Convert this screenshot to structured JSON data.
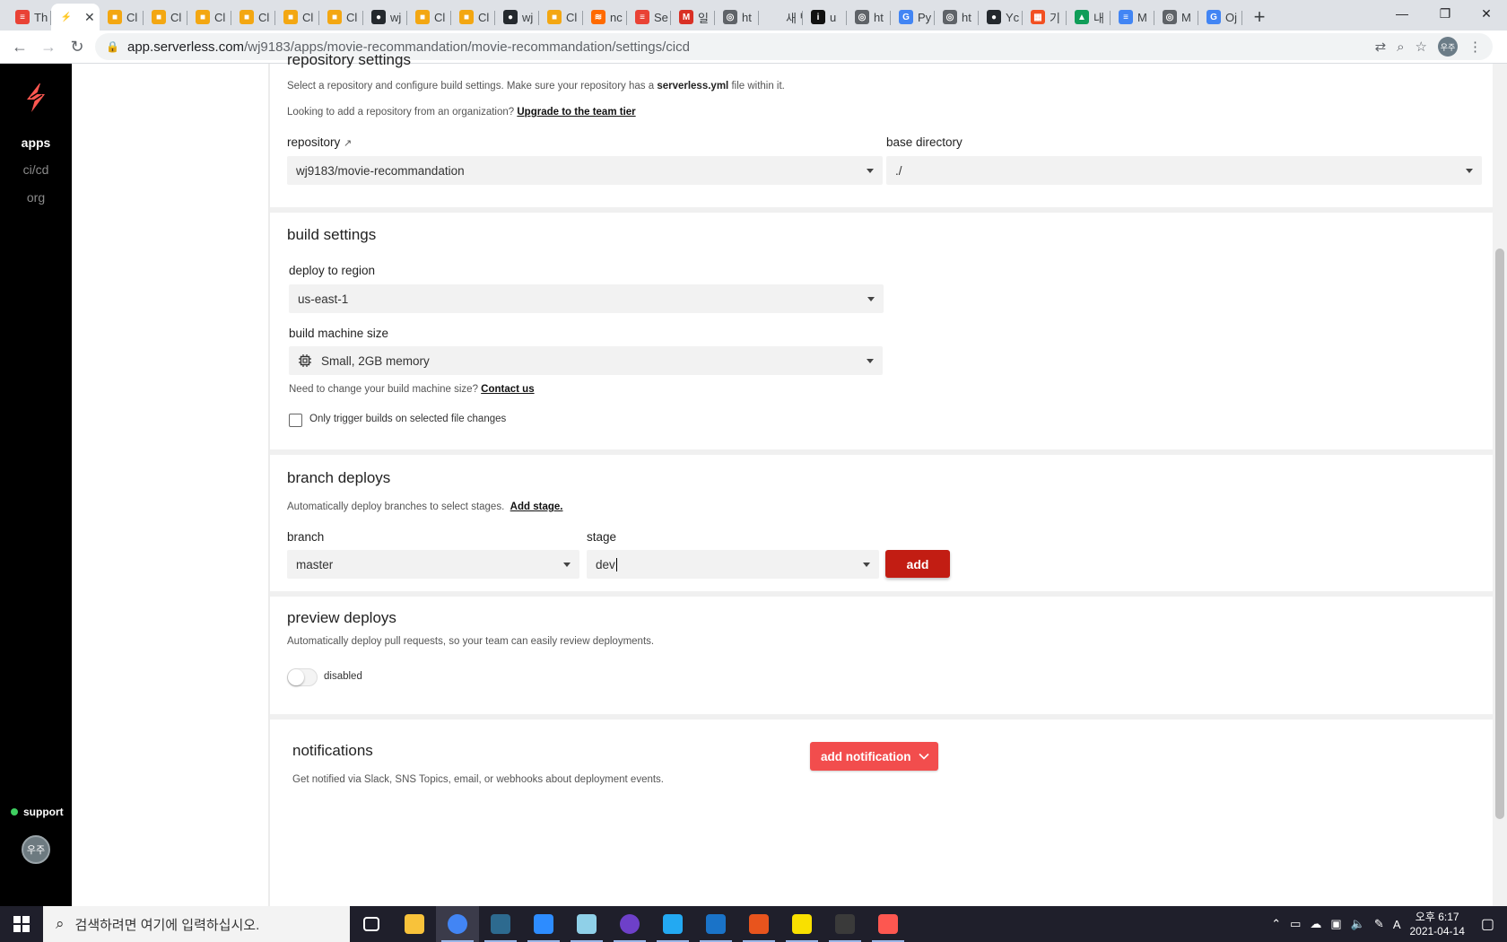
{
  "browser": {
    "tabs": [
      {
        "label": "Th",
        "color": "#e94235",
        "glyph": "≡"
      },
      {
        "label": "",
        "color": "#ffffff",
        "glyph": "⚡",
        "active": true
      },
      {
        "label": "Cl",
        "color": "#f3a712",
        "glyph": "■"
      },
      {
        "label": "Cl",
        "color": "#f3a712",
        "glyph": "■"
      },
      {
        "label": "Cl",
        "color": "#f3a712",
        "glyph": "■"
      },
      {
        "label": "Cl",
        "color": "#f3a712",
        "glyph": "■"
      },
      {
        "label": "Cl",
        "color": "#f3a712",
        "glyph": "■"
      },
      {
        "label": "Cl",
        "color": "#f3a712",
        "glyph": "■"
      },
      {
        "label": "wj",
        "color": "#24292e",
        "glyph": "●"
      },
      {
        "label": "Cl",
        "color": "#f3a712",
        "glyph": "■"
      },
      {
        "label": "Cl",
        "color": "#f3a712",
        "glyph": "■"
      },
      {
        "label": "wj",
        "color": "#24292e",
        "glyph": "●"
      },
      {
        "label": "Cl",
        "color": "#f3a712",
        "glyph": "■"
      },
      {
        "label": "nc",
        "color": "#ff6a00",
        "glyph": "≋"
      },
      {
        "label": "Se",
        "color": "#e94235",
        "glyph": "≡"
      },
      {
        "label": "일",
        "color": "#d93025",
        "glyph": "M"
      },
      {
        "label": "ht",
        "color": "#5f6368",
        "glyph": "◎"
      },
      {
        "label": "새 탭",
        "color": "#dee1e6",
        "glyph": ""
      },
      {
        "label": "u",
        "color": "#111111",
        "glyph": "i"
      },
      {
        "label": "ht",
        "color": "#5f6368",
        "glyph": "◎"
      },
      {
        "label": "Py",
        "color": "#4285f4",
        "glyph": "G"
      },
      {
        "label": "ht",
        "color": "#5f6368",
        "glyph": "◎"
      },
      {
        "label": "Yc",
        "color": "#24292e",
        "glyph": "●"
      },
      {
        "label": "기",
        "color": "#f25022",
        "glyph": "▦"
      },
      {
        "label": "내",
        "color": "#0f9d58",
        "glyph": "▲"
      },
      {
        "label": "M",
        "color": "#4285f4",
        "glyph": "≡"
      },
      {
        "label": "M",
        "color": "#5f6368",
        "glyph": "◎"
      },
      {
        "label": "Oj",
        "color": "#4285f4",
        "glyph": "G"
      }
    ],
    "url_host": "app.serverless.com",
    "url_path": "/wj9183/apps/movie-recommandation/movie-recommandation/settings/cicd",
    "profile_initials": "우주"
  },
  "sidenav": {
    "items": [
      {
        "label": "apps",
        "active": true
      },
      {
        "label": "ci/cd",
        "active": false
      },
      {
        "label": "org",
        "active": false
      }
    ],
    "support_label": "support",
    "user_initials": "우주"
  },
  "repository_settings": {
    "title": "repository settings",
    "desc_prefix": "Select a repository and configure build settings. Make sure your repository has a ",
    "desc_file": "serverless.yml",
    "desc_suffix": " file within it.",
    "org_prefix": "Looking to add a repository from an organization? ",
    "org_link": "Upgrade to the team tier",
    "repository_label": "repository",
    "repository_value": "wj9183/movie-recommandation",
    "base_dir_label": "base directory",
    "base_dir_value": "./"
  },
  "build_settings": {
    "title": "build settings",
    "region_label": "deploy to region",
    "region_value": "us-east-1",
    "machine_label": "build machine size",
    "machine_value": "Small, 2GB memory",
    "change_prefix": "Need to change your build machine size? ",
    "change_link": "Contact us",
    "checkbox_label": "Only trigger builds on selected file changes"
  },
  "branch_deploys": {
    "title": "branch deploys",
    "desc": "Automatically deploy branches to select stages.",
    "add_stage_link": "Add stage.",
    "branch_label": "branch",
    "branch_value": "master",
    "stage_label": "stage",
    "stage_value": "dev",
    "add_button": "add"
  },
  "preview_deploys": {
    "title": "preview deploys",
    "desc": "Automatically deploy pull requests, so your team can easily review deployments.",
    "toggle_state": "disabled"
  },
  "notifications": {
    "title": "notifications",
    "desc": "Get notified via Slack, SNS Topics, email, or webhooks about deployment events.",
    "add_button": "add notification"
  },
  "taskbar": {
    "search_placeholder": "검색하려면 여기에 입력하십시오.",
    "apps": [
      {
        "name": "task-view-icon",
        "color": "#ffffff"
      },
      {
        "name": "file-explorer-icon",
        "color": "#f8c23a"
      },
      {
        "name": "chrome-icon",
        "color": "#4285f4"
      },
      {
        "name": "mysql-workbench-icon",
        "color": "#2d6a8f"
      },
      {
        "name": "zoom-icon",
        "color": "#2d8cff"
      },
      {
        "name": "notepad-icon",
        "color": "#8fd0e8"
      },
      {
        "name": "github-desktop-icon",
        "color": "#6e40c9"
      },
      {
        "name": "vscode-icon",
        "color": "#23a9f2"
      },
      {
        "name": "media-player-icon",
        "color": "#1a73c8"
      },
      {
        "name": "office-icon",
        "color": "#e8541d"
      },
      {
        "name": "kakaotalk-icon",
        "color": "#f9e000"
      },
      {
        "name": "terminal-icon",
        "color": "#3a3a3a"
      },
      {
        "name": "serverless-icon",
        "color": "#fd5750"
      }
    ],
    "ime_label": "A",
    "time": "오후 6:17",
    "date": "2021-04-14"
  }
}
